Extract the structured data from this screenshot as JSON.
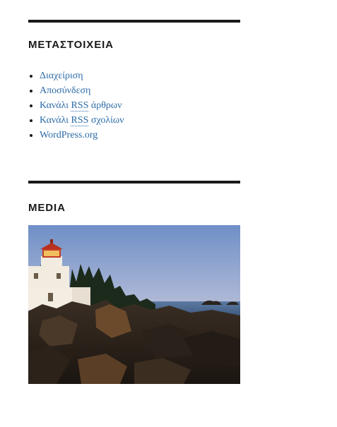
{
  "meta_widget": {
    "title": "ΜΕΤΑΣΤΟΙΧΕΙΑ",
    "links": [
      {
        "label": "Διαχείριση"
      },
      {
        "label": "Αποσύνδεση"
      },
      {
        "prefix": "Κανάλι ",
        "abbr": "RSS",
        "suffix": " άρθρων"
      },
      {
        "prefix": "Κανάλι ",
        "abbr": "RSS",
        "suffix": " σχολίων"
      },
      {
        "label": "WordPress.org"
      }
    ]
  },
  "media_widget": {
    "title": "MEDIA",
    "image_subject": "lighthouse-on-rocky-coast"
  },
  "colors": {
    "text": "#1a1a1a",
    "link": "#2b6aa8",
    "rule": "#1a1a1a"
  }
}
